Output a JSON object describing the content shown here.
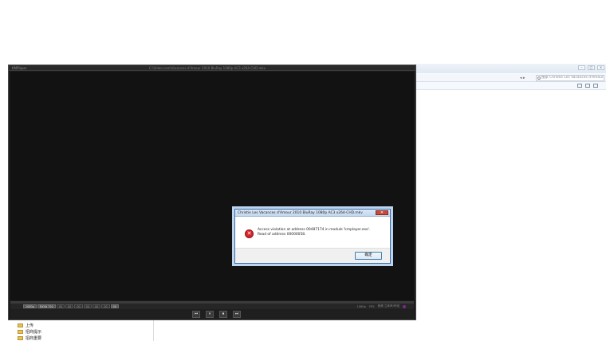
{
  "explorer": {
    "window_controls": [
      "–",
      "□",
      "×"
    ],
    "nav_arrows": "◂ ▸",
    "search_placeholder": "搜索 Christie Les Vacances d'Amour",
    "tree": [
      "上传",
      "招商提示",
      "招商重要"
    ]
  },
  "player": {
    "app_name": "KMPlayer",
    "path": "C:\\Video.com\\Vacances d'Amour 2010 BluRay 1080p AC3 x264-CHD.mkv",
    "badges": [
      "1080p",
      "DXVA 720",
      "00",
      "00",
      "00",
      "00",
      "00",
      "00",
      "00"
    ],
    "status_right": [
      "1080p",
      "FPS",
      "音频 立体声/环绕"
    ],
    "controls": [
      "⏮",
      "⏸",
      "⏹",
      "⏭"
    ]
  },
  "dialog": {
    "title": "Christie Les Vacances d'Amour 2010 BluRay 1080p AC3 x264-CHD.mkv",
    "close": "✕",
    "icon": "error-icon",
    "message_line1": "Access violation at address 00487174 in module 'kmplayer.exe'.",
    "message_line2": "Read of address 00000058.",
    "ok_label": "确定"
  }
}
